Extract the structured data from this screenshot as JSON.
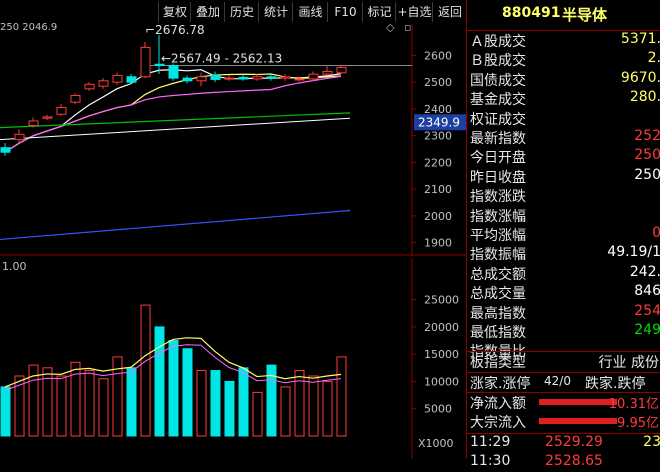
{
  "toolbar": {
    "buttons": [
      "复权",
      "叠加",
      "历史",
      "统计",
      "画线",
      "F10",
      "标记",
      "+自选",
      "返回"
    ]
  },
  "header": {
    "code": "880491",
    "name": "半导体",
    "ma_label": "250 2046.9",
    "diamond": "◇",
    "close": "▫"
  },
  "chart": {
    "price_ticks": [
      "2600",
      "2500",
      "2400",
      "2300",
      "2200",
      "2100",
      "2000",
      "1900"
    ],
    "price_min": 1850,
    "price_max": 2680,
    "current_price": "2349.9",
    "high_label": "2676.78",
    "range_label": "2567.49 - 2562.13",
    "vol_ticks": [
      "25000",
      "20000",
      "15000",
      "10000",
      "5000"
    ],
    "vol_unit": "X1000",
    "vol_ma_label": "1.00",
    "candles": [
      {
        "o": 2255,
        "c": 2238,
        "h": 2272,
        "l": 2225
      },
      {
        "o": 2285,
        "c": 2305,
        "h": 2325,
        "l": 2275
      },
      {
        "o": 2338,
        "c": 2355,
        "h": 2368,
        "l": 2330
      },
      {
        "o": 2365,
        "c": 2370,
        "h": 2378,
        "l": 2358
      },
      {
        "o": 2380,
        "c": 2405,
        "h": 2418,
        "l": 2374
      },
      {
        "o": 2425,
        "c": 2450,
        "h": 2458,
        "l": 2418
      },
      {
        "o": 2475,
        "c": 2492,
        "h": 2500,
        "l": 2468
      },
      {
        "o": 2485,
        "c": 2505,
        "h": 2515,
        "l": 2475
      },
      {
        "o": 2500,
        "c": 2525,
        "h": 2535,
        "l": 2490
      },
      {
        "o": 2520,
        "c": 2500,
        "h": 2530,
        "l": 2492
      },
      {
        "o": 2520,
        "c": 2630,
        "h": 2650,
        "l": 2515
      },
      {
        "o": 2567,
        "c": 2562,
        "h": 2676,
        "l": 2530
      },
      {
        "o": 2562,
        "c": 2515,
        "h": 2570,
        "l": 2505
      },
      {
        "o": 2515,
        "c": 2505,
        "h": 2525,
        "l": 2495
      },
      {
        "o": 2505,
        "c": 2520,
        "h": 2535,
        "l": 2485
      },
      {
        "o": 2525,
        "c": 2510,
        "h": 2540,
        "l": 2500
      },
      {
        "o": 2515,
        "c": 2515,
        "h": 2525,
        "l": 2505
      },
      {
        "o": 2518,
        "c": 2512,
        "h": 2528,
        "l": 2505
      },
      {
        "o": 2512,
        "c": 2520,
        "h": 2530,
        "l": 2505
      },
      {
        "o": 2520,
        "c": 2515,
        "h": 2528,
        "l": 2505
      },
      {
        "o": 2515,
        "c": 2520,
        "h": 2530,
        "l": 2505
      },
      {
        "o": 2510,
        "c": 2512,
        "h": 2520,
        "l": 2502
      },
      {
        "o": 2512,
        "c": 2530,
        "h": 2540,
        "l": 2505
      },
      {
        "o": 2530,
        "c": 2540,
        "h": 2560,
        "l": 2525
      },
      {
        "o": 2535,
        "c": 2555,
        "h": 2565,
        "l": 2530
      }
    ],
    "volumes": [
      9000,
      11000,
      13000,
      12500,
      11000,
      13500,
      12000,
      10500,
      14500,
      12500,
      24000,
      20000,
      17500,
      16000,
      12000,
      12000,
      10000,
      12500,
      8000,
      13000,
      9000,
      12000,
      11000,
      10000,
      14500
    ],
    "vol_up": [
      false,
      true,
      true,
      true,
      true,
      true,
      true,
      true,
      true,
      false,
      true,
      false,
      false,
      false,
      true,
      false,
      false,
      false,
      true,
      false,
      true,
      true,
      true,
      true,
      true
    ]
  },
  "panel": {
    "rows": [
      {
        "label": "Ａ股成交",
        "value": "5371."
      },
      {
        "label": "Ｂ股成交",
        "value": "2."
      },
      {
        "label": "国债成交",
        "value": "9670."
      },
      {
        "label": "基金成交",
        "value": "280."
      },
      {
        "label": "权证成交",
        "value": ""
      },
      {
        "label": "最新指数",
        "value": "252"
      },
      {
        "label": "今日开盘",
        "value": "250"
      },
      {
        "label": "昨日收盘",
        "value": "250"
      },
      {
        "label": "指数涨跌",
        "value": ""
      },
      {
        "label": "指数涨幅",
        "value": ""
      },
      {
        "label": "平均涨幅",
        "value": "0"
      },
      {
        "label": "指数振幅",
        "value": "49.19/1"
      },
      {
        "label": "总成交额",
        "value": "242."
      },
      {
        "label": "总成交量",
        "value": "846"
      },
      {
        "label": "最高指数",
        "value": "254"
      },
      {
        "label": "最低指数",
        "value": "249"
      },
      {
        "label": "指数量比",
        "value": ""
      }
    ],
    "board_label": "板指类型",
    "board_value": "行业 成份",
    "updown_label": "涨家.涨停",
    "updown_value": "42/0",
    "down_label": "跌家.跌停",
    "flow_rows": [
      {
        "label": "净流入额",
        "value": "10.31亿"
      },
      {
        "label": "大宗流入",
        "value": "9.95亿"
      }
    ],
    "ticks": [
      {
        "time": "11:29",
        "price": "2529.29",
        "extra": "23"
      },
      {
        "time": "11:30",
        "price": "2528.65",
        "extra": ""
      }
    ],
    "colors": {
      "up": "#ff3b3b",
      "down": "#00e5e5",
      "label": "#e6e6e6",
      "green": "#00e000",
      "yellow": "#ffff66"
    }
  }
}
